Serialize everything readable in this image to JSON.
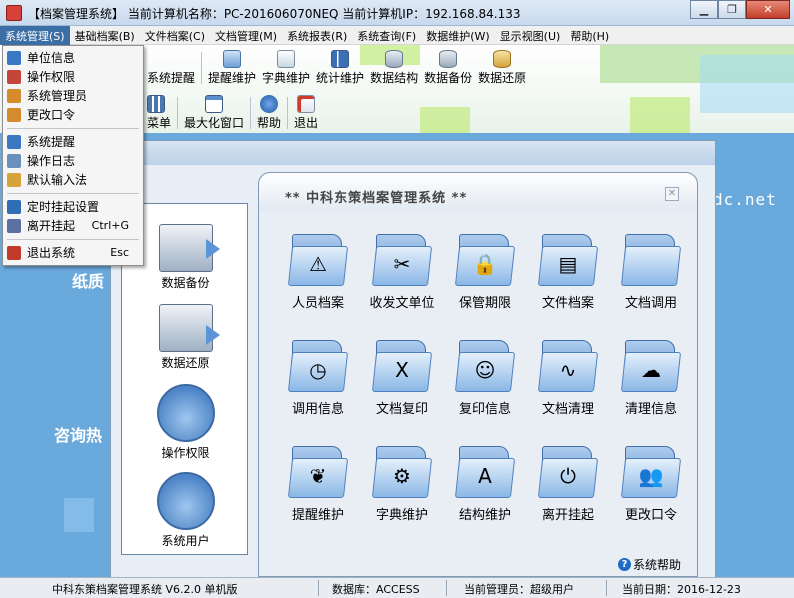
{
  "window": {
    "title": "【档案管理系统】  当前计算机名称：PC-201606070NEQ  当前计算机IP：192.168.84.133",
    "min_label": "▁",
    "max_label": "❐",
    "close_label": "✕"
  },
  "menubar": [
    {
      "label": "系统管理(S)",
      "active": true
    },
    {
      "label": "基础档案(B)"
    },
    {
      "label": "文件档案(C)"
    },
    {
      "label": "文档管理(M)"
    },
    {
      "label": "系统报表(R)"
    },
    {
      "label": "系统查询(F)"
    },
    {
      "label": "数据维护(W)"
    },
    {
      "label": "显示视图(U)"
    },
    {
      "label": "帮助(H)"
    }
  ],
  "toolbar_row1": [
    {
      "label": "系统提醒",
      "icon": "bell-icon"
    },
    {
      "label": "提醒维护",
      "icon": "wrench-icon"
    },
    {
      "label": "字典维护",
      "icon": "dictionary-icon"
    },
    {
      "label": "统计维护",
      "icon": "chart-icon"
    },
    {
      "label": "数据结构",
      "icon": "database-icon"
    },
    {
      "label": "数据备份",
      "icon": "database-icon"
    },
    {
      "label": "数据还原",
      "icon": "database-icon"
    }
  ],
  "toolbar_row2": [
    {
      "label": "菜单",
      "icon": "grid-icon"
    },
    {
      "label": "最大化窗口",
      "icon": "window-icon"
    },
    {
      "label": "帮助",
      "icon": "help-icon"
    },
    {
      "label": "退出",
      "icon": "exit-icon"
    }
  ],
  "dropdown": {
    "items": [
      {
        "label": "单位信息",
        "icon": "document-icon",
        "color": "#3b78c4"
      },
      {
        "label": "操作权限",
        "icon": "pen-icon",
        "color": "#c4453b"
      },
      {
        "label": "系统管理员",
        "icon": "user-icon",
        "color": "#d48b2c"
      },
      {
        "label": "更改口令",
        "icon": "user-key-icon",
        "color": "#d48b2c"
      },
      {
        "label": "系统提醒",
        "icon": "document-icon",
        "color": "#3b78c4"
      },
      {
        "label": "操作日志",
        "icon": "log-icon",
        "color": "#6a8fbd"
      },
      {
        "label": "默认输入法",
        "icon": "keyboard-icon",
        "color": "#d6a23b"
      },
      {
        "label": "定时挂起设置",
        "icon": "clock-icon",
        "color": "#2f6db5"
      },
      {
        "label": "离开挂起",
        "icon": "tools-icon",
        "color": "#5b6fa0",
        "shortcut": "Ctrl+G"
      },
      {
        "label": "退出系统",
        "icon": "exit-icon",
        "color": "#c23a2c",
        "shortcut": "Esc"
      }
    ]
  },
  "background": {
    "url_text": "dc.net",
    "left_text1": "纸质",
    "left_text2": "咨询热"
  },
  "left_panel": [
    {
      "label": "数据备份",
      "icon": "backup-icon"
    },
    {
      "label": "数据还原",
      "icon": "restore-icon"
    },
    {
      "label": "操作权限",
      "icon": "permission-folder-icon"
    },
    {
      "label": "系统用户",
      "icon": "user-folder-icon"
    }
  ],
  "main_panel": {
    "title": "** 中科东策档案管理系统 **",
    "close_label": "✕",
    "items": [
      {
        "label": "人员档案",
        "icon": "person-sign-icon",
        "glyph": "⚠"
      },
      {
        "label": "收发文单位",
        "icon": "tools-icon",
        "glyph": "✂"
      },
      {
        "label": "保管期限",
        "icon": "lock-icon",
        "glyph": "🔒"
      },
      {
        "label": "文件档案",
        "icon": "document-icon",
        "glyph": "▤"
      },
      {
        "label": "文档调用",
        "icon": "folder-icon",
        "glyph": ""
      },
      {
        "label": "调用信息",
        "icon": "stopwatch-icon",
        "glyph": "◷"
      },
      {
        "label": "文档复印",
        "icon": "copy-x-icon",
        "glyph": "X"
      },
      {
        "label": "复印信息",
        "icon": "finder-icon",
        "glyph": "☺"
      },
      {
        "label": "文档清理",
        "icon": "audio-icon",
        "glyph": "∿"
      },
      {
        "label": "清理信息",
        "icon": "cloud-icon",
        "glyph": "☁"
      },
      {
        "label": "提醒维护",
        "icon": "bird-icon",
        "glyph": "❦"
      },
      {
        "label": "字典维护",
        "icon": "gears-icon",
        "glyph": "⚙"
      },
      {
        "label": "结构维护",
        "icon": "triangle-icon",
        "glyph": "A"
      },
      {
        "label": "离开挂起",
        "icon": "power-icon",
        "glyph": "⏻"
      },
      {
        "label": "更改口令",
        "icon": "users-icon",
        "glyph": "👥"
      }
    ],
    "help_label": "系统帮助"
  },
  "statusbar": {
    "app": "中科东策档案管理系统 V6.2.0 单机版",
    "database": "数据库：ACCESS",
    "admin": "当前管理员：超级用户",
    "date": "当前日期：2016-12-23"
  }
}
